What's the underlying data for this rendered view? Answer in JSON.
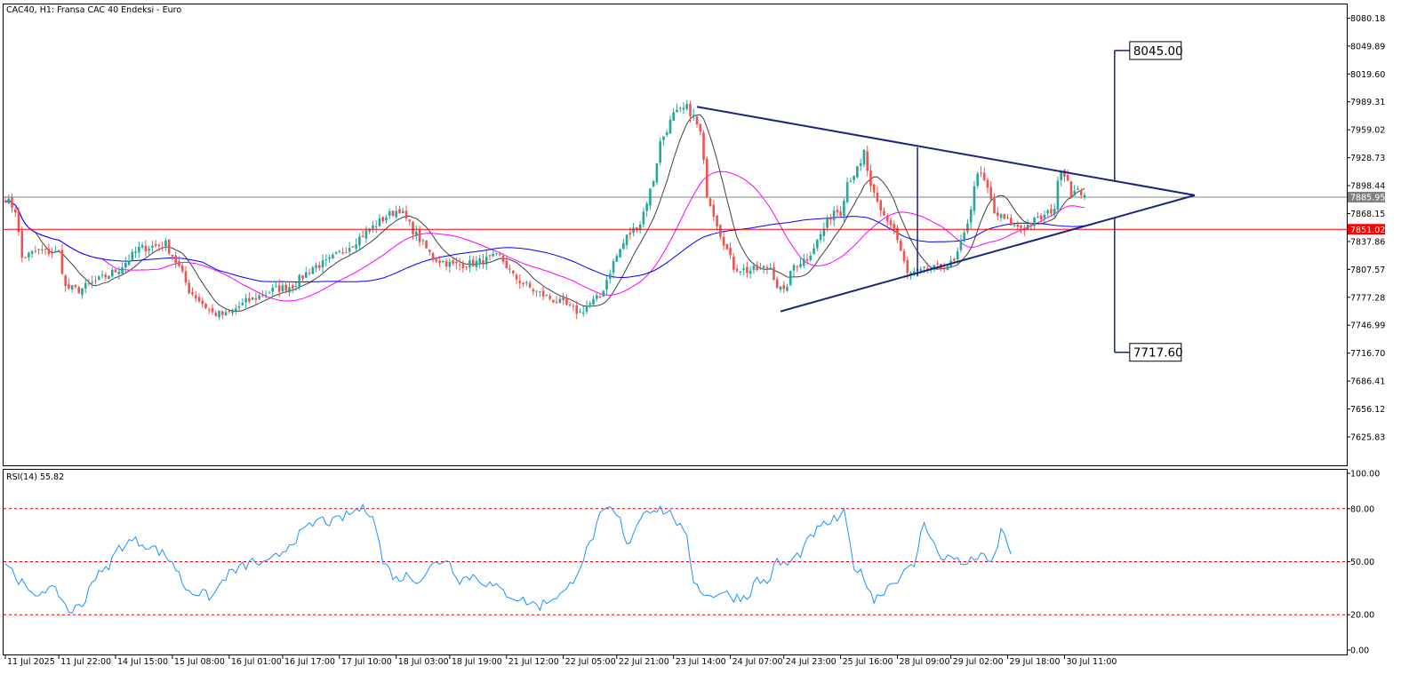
{
  "chart_data": [
    {
      "type": "candlestick",
      "title": "CAC40, H1:  Fransa CAC 40 Endeksi - Euro",
      "ylim": [
        7595,
        8095
      ],
      "y_ticks": [
        "8080.18",
        "8049.89",
        "8019.60",
        "7989.31",
        "7959.02",
        "7928.73",
        "7898.44",
        "7868.15",
        "7837.86",
        "7807.57",
        "7777.28",
        "7746.99",
        "7716.70",
        "7686.41",
        "7656.12",
        "7625.83"
      ],
      "y_tick_values": [
        8080.18,
        8049.89,
        8019.6,
        7989.31,
        7959.02,
        7928.73,
        7898.44,
        7868.15,
        7837.86,
        7807.57,
        7777.28,
        7746.99,
        7716.7,
        7686.41,
        7656.12,
        7625.83
      ],
      "x_ticks": [
        "11 Jul 2025",
        "11 Jul 22:00",
        "14 Jul 15:00",
        "15 Jul 08:00",
        "16 Jul 01:00",
        "16 Jul 17:00",
        "17 Jul 10:00",
        "18 Jul 03:00",
        "18 Jul 19:00",
        "21 Jul 12:00",
        "22 Jul 05:00",
        "22 Jul 21:00",
        "23 Jul 14:00",
        "24 Jul 07:00",
        "24 Jul 23:00",
        "25 Jul 16:00",
        "28 Jul 09:00",
        "29 Jul 02:00",
        "29 Jul 18:00",
        "30 Jul 11:00"
      ],
      "x_tick_index": [
        0,
        16,
        33,
        50,
        67,
        83,
        100,
        117,
        133,
        150,
        167,
        183,
        200,
        217,
        233,
        250,
        267,
        283,
        300,
        317
      ],
      "bar_count": 324,
      "close_path": [
        [
          0,
          7885
        ],
        [
          3,
          7872
        ],
        [
          5,
          7820
        ],
        [
          10,
          7828
        ],
        [
          16,
          7825
        ],
        [
          18,
          7788
        ],
        [
          22,
          7785
        ],
        [
          30,
          7800
        ],
        [
          34,
          7808
        ],
        [
          40,
          7830
        ],
        [
          48,
          7835
        ],
        [
          52,
          7810
        ],
        [
          55,
          7785
        ],
        [
          62,
          7760
        ],
        [
          66,
          7758
        ],
        [
          72,
          7772
        ],
        [
          80,
          7785
        ],
        [
          86,
          7790
        ],
        [
          92,
          7810
        ],
        [
          96,
          7815
        ],
        [
          102,
          7830
        ],
        [
          108,
          7848
        ],
        [
          114,
          7865
        ],
        [
          118,
          7873
        ],
        [
          122,
          7850
        ],
        [
          128,
          7820
        ],
        [
          134,
          7812
        ],
        [
          140,
          7814
        ],
        [
          146,
          7820
        ],
        [
          148,
          7822
        ],
        [
          152,
          7800
        ],
        [
          158,
          7785
        ],
        [
          162,
          7778
        ],
        [
          168,
          7768
        ],
        [
          172,
          7760
        ],
        [
          174,
          7768
        ],
        [
          178,
          7778
        ],
        [
          182,
          7815
        ],
        [
          186,
          7843
        ],
        [
          190,
          7858
        ],
        [
          194,
          7905
        ],
        [
          196,
          7945
        ],
        [
          200,
          7975
        ],
        [
          204,
          7983
        ],
        [
          206,
          7973
        ],
        [
          208,
          7955
        ],
        [
          210,
          7890
        ],
        [
          214,
          7847
        ],
        [
          218,
          7810
        ],
        [
          222,
          7806
        ],
        [
          226,
          7808
        ],
        [
          229,
          7810
        ],
        [
          231,
          7790
        ],
        [
          233,
          7782
        ],
        [
          236,
          7812
        ],
        [
          240,
          7820
        ],
        [
          244,
          7845
        ],
        [
          248,
          7872
        ],
        [
          250,
          7870
        ],
        [
          252,
          7903
        ],
        [
          256,
          7920
        ],
        [
          257,
          7935
        ],
        [
          259,
          7895
        ],
        [
          262,
          7870
        ],
        [
          266,
          7852
        ],
        [
          270,
          7802
        ],
        [
          274,
          7805
        ],
        [
          280,
          7810
        ],
        [
          284,
          7815
        ],
        [
          287,
          7845
        ],
        [
          289,
          7875
        ],
        [
          291,
          7915
        ],
        [
          294,
          7895
        ],
        [
          296,
          7868
        ],
        [
          299,
          7862
        ],
        [
          302,
          7855
        ],
        [
          305,
          7853
        ],
        [
          308,
          7860
        ],
        [
          311,
          7865
        ],
        [
          314,
          7875
        ],
        [
          315,
          7900
        ],
        [
          316,
          7918
        ],
        [
          318,
          7905
        ],
        [
          319,
          7891
        ]
      ],
      "current_price": "7885.95",
      "current_value": 7885.95,
      "red_level": "7851.02",
      "red_value": 7851.02,
      "targets": [
        {
          "label": "8045.00",
          "value": 8045.0
        },
        {
          "label": "7717.60",
          "value": 7717.6
        }
      ],
      "triangle": {
        "upper": [
          [
            207,
            7984
          ],
          [
            356,
            7888
          ]
        ],
        "lower": [
          [
            232,
            7762
          ],
          [
            356,
            7888
          ]
        ],
        "height_marker": [
          [
            273,
            7940
          ],
          [
            273,
            7800
          ]
        ]
      },
      "series": [
        {
          "color": "#404040"
        },
        {
          "color": "#ff00ff"
        },
        {
          "color": "#0000ff"
        }
      ],
      "colors": {
        "up": "#26a69a",
        "down": "#ef5350",
        "pattern": "#1a237e",
        "red_line": "#ff0000",
        "grid": "#808080"
      }
    },
    {
      "type": "line",
      "title": "RSI(14) 55.82",
      "ylim": [
        0,
        100
      ],
      "y_ticks": [
        "100.00",
        "80.00",
        "50.00",
        "20.00",
        "0.00"
      ],
      "y_tick_values": [
        100,
        80,
        50,
        20,
        0
      ],
      "levels": [
        80,
        50,
        20
      ],
      "path": [
        [
          0,
          50
        ],
        [
          4,
          40
        ],
        [
          8,
          30
        ],
        [
          12,
          35
        ],
        [
          16,
          32
        ],
        [
          19,
          22
        ],
        [
          23,
          25
        ],
        [
          26,
          40
        ],
        [
          30,
          45
        ],
        [
          34,
          58
        ],
        [
          38,
          62
        ],
        [
          42,
          60
        ],
        [
          46,
          56
        ],
        [
          50,
          50
        ],
        [
          54,
          35
        ],
        [
          58,
          32
        ],
        [
          62,
          30
        ],
        [
          66,
          42
        ],
        [
          70,
          46
        ],
        [
          74,
          50
        ],
        [
          78,
          48
        ],
        [
          82,
          54
        ],
        [
          86,
          62
        ],
        [
          90,
          68
        ],
        [
          94,
          74
        ],
        [
          98,
          72
        ],
        [
          102,
          76
        ],
        [
          106,
          80
        ],
        [
          110,
          78
        ],
        [
          113,
          50
        ],
        [
          117,
          40
        ],
        [
          120,
          42
        ],
        [
          124,
          40
        ],
        [
          128,
          48
        ],
        [
          132,
          52
        ],
        [
          136,
          40
        ],
        [
          140,
          42
        ],
        [
          144,
          38
        ],
        [
          150,
          32
        ],
        [
          155,
          28
        ],
        [
          160,
          25
        ],
        [
          164,
          30
        ],
        [
          168,
          33
        ],
        [
          172,
          48
        ],
        [
          175,
          60
        ],
        [
          178,
          75
        ],
        [
          181,
          80
        ],
        [
          184,
          73
        ],
        [
          186,
          58
        ],
        [
          189,
          72
        ],
        [
          192,
          80
        ],
        [
          196,
          80
        ],
        [
          200,
          76
        ],
        [
          204,
          62
        ],
        [
          206,
          40
        ],
        [
          210,
          30
        ],
        [
          214,
          33
        ],
        [
          218,
          30
        ],
        [
          222,
          30
        ],
        [
          225,
          40
        ],
        [
          228,
          38
        ],
        [
          231,
          50
        ],
        [
          234,
          48
        ],
        [
          238,
          55
        ],
        [
          242,
          66
        ],
        [
          246,
          72
        ],
        [
          249,
          74
        ],
        [
          251,
          77
        ],
        [
          254,
          48
        ],
        [
          258,
          38
        ],
        [
          260,
          28
        ],
        [
          264,
          36
        ],
        [
          268,
          42
        ],
        [
          272,
          48
        ],
        [
          275,
          73
        ],
        [
          277,
          65
        ],
        [
          280,
          50
        ],
        [
          283,
          55
        ],
        [
          286,
          48
        ],
        [
          289,
          50
        ],
        [
          292,
          55
        ],
        [
          294,
          48
        ],
        [
          296,
          52
        ],
        [
          298,
          68
        ],
        [
          300,
          60
        ],
        [
          301,
          56
        ]
      ],
      "line_color": "#1e90ff",
      "level_color": "#d00000"
    }
  ]
}
